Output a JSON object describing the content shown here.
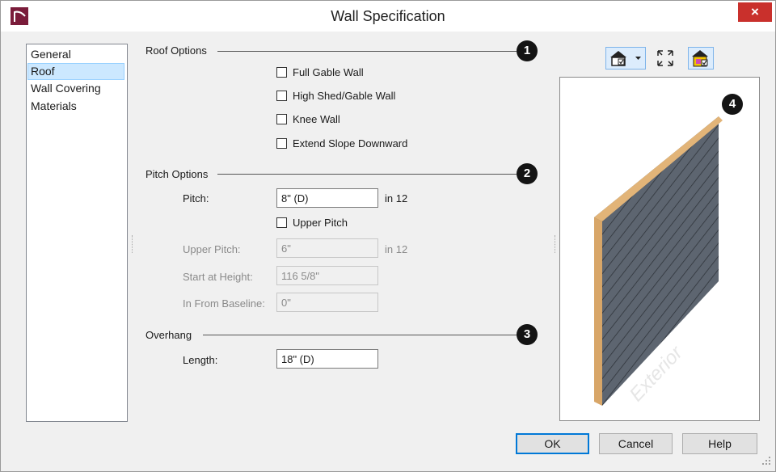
{
  "window": {
    "title": "Wall Specification",
    "close_glyph": "×"
  },
  "nav": {
    "items": [
      "General",
      "Roof",
      "Wall Covering",
      "Materials"
    ],
    "selected": "Roof"
  },
  "roof_options": {
    "heading": "Roof Options",
    "badge": "1",
    "checkboxes": [
      {
        "label": "Full Gable Wall",
        "checked": false
      },
      {
        "label": "High Shed/Gable Wall",
        "checked": false
      },
      {
        "label": "Knee Wall",
        "checked": false
      },
      {
        "label": "Extend Slope Downward",
        "checked": false
      }
    ]
  },
  "pitch_options": {
    "heading": "Pitch Options",
    "badge": "2",
    "pitch_label": "Pitch:",
    "pitch_value": "8\" (D)",
    "pitch_unit": "in 12",
    "upper_pitch_checkbox": {
      "label": "Upper Pitch",
      "checked": false
    },
    "upper_pitch_label": "Upper Pitch:",
    "upper_pitch_value": "6\"",
    "upper_pitch_unit": "in 12",
    "start_height_label": "Start at Height:",
    "start_height_value": "116 5/8\"",
    "in_from_baseline_label": "In From Baseline:",
    "in_from_baseline_value": "0\""
  },
  "overhang": {
    "heading": "Overhang",
    "badge": "3",
    "length_label": "Length:",
    "length_value": "18\" (D)"
  },
  "preview": {
    "badge": "4",
    "wall_text": "Exterior"
  },
  "toolbar": {
    "icons": [
      "view-display-icon",
      "dropdown-arrow-icon",
      "fill-window-icon",
      "color-toggle-icon"
    ]
  },
  "buttons": {
    "ok": "OK",
    "cancel": "Cancel",
    "help": "Help"
  },
  "colors": {
    "selection": "#cce8ff",
    "wall_face": "#5d6570",
    "wall_edge": "#e8b87a",
    "close_red": "#c9302c"
  }
}
